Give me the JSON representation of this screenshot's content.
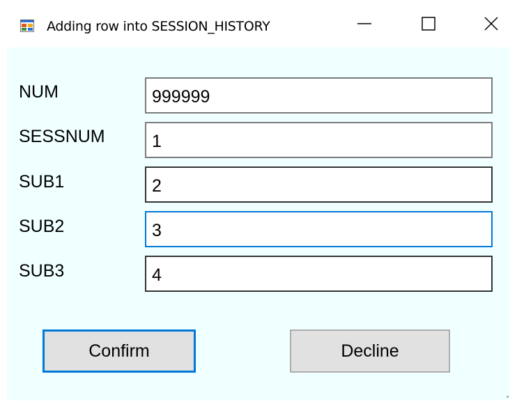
{
  "window": {
    "title": "Adding row into SESSION_HISTORY",
    "icon": "form-app-icon",
    "controls": [
      "minimize-icon",
      "maximize-icon",
      "close-icon"
    ]
  },
  "form": {
    "fields": [
      {
        "label": "NUM",
        "value": "999999"
      },
      {
        "label": "SESSNUM",
        "value": "1"
      },
      {
        "label": "SUB1",
        "value": "2"
      },
      {
        "label": "SUB2",
        "value": "3"
      },
      {
        "label": "SUB3",
        "value": "4"
      }
    ]
  },
  "buttons": {
    "confirm": "Confirm",
    "decline": "Decline"
  },
  "colors": {
    "client_background": "#f0ffff",
    "focus_accent": "#0078d7",
    "button_face": "#e1e1e1"
  }
}
